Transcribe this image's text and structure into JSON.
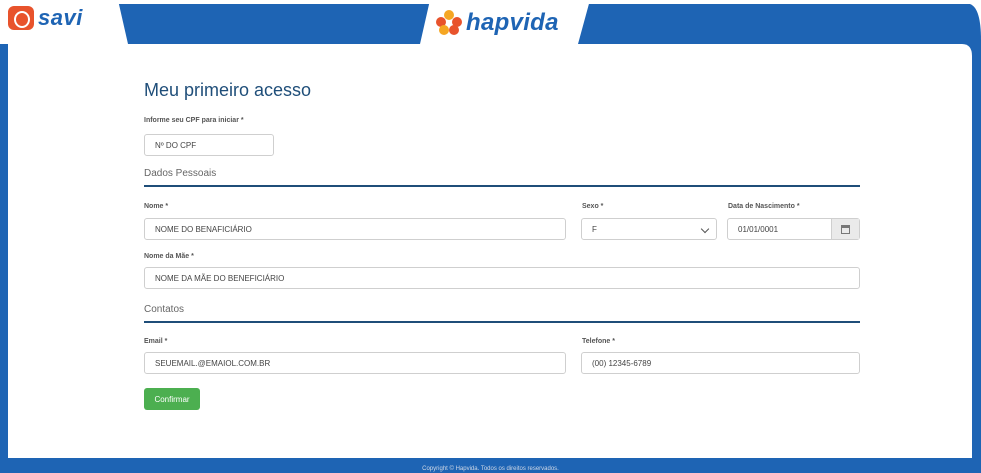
{
  "header": {
    "left_brand": "savi",
    "center_brand": "hapvida"
  },
  "form": {
    "title": "Meu primeiro acesso",
    "cpf": {
      "label": "Informe seu CPF para iniciar *",
      "value": "Nº DO CPF"
    },
    "section_personal": "Dados Pessoais",
    "nome": {
      "label": "Nome *",
      "value": "NOME DO BENAFICIÁRIO"
    },
    "sexo": {
      "label": "Sexo *",
      "value": "F"
    },
    "nascimento": {
      "label": "Data de Nascimento *",
      "value": "01/01/0001"
    },
    "mae": {
      "label": "Nome da Mãe *",
      "value": "NOME DA MÃE DO BENEFICIÁRIO"
    },
    "section_contacts": "Contatos",
    "email": {
      "label": "Email *",
      "value": "SEUEMAIL.@EMAIOL.COM.BR"
    },
    "telefone": {
      "label": "Telefone *",
      "value": "(00) 12345-6789"
    },
    "confirm_label": "Confirmar"
  },
  "footer": {
    "text": "Copyright © Hapvida. Todos os direitos reservados."
  },
  "colors": {
    "frame_blue": "#1e64b4",
    "savi_orange": "#e8532c",
    "title_blue": "#1f4e79",
    "confirm_green": "#4caf50"
  }
}
